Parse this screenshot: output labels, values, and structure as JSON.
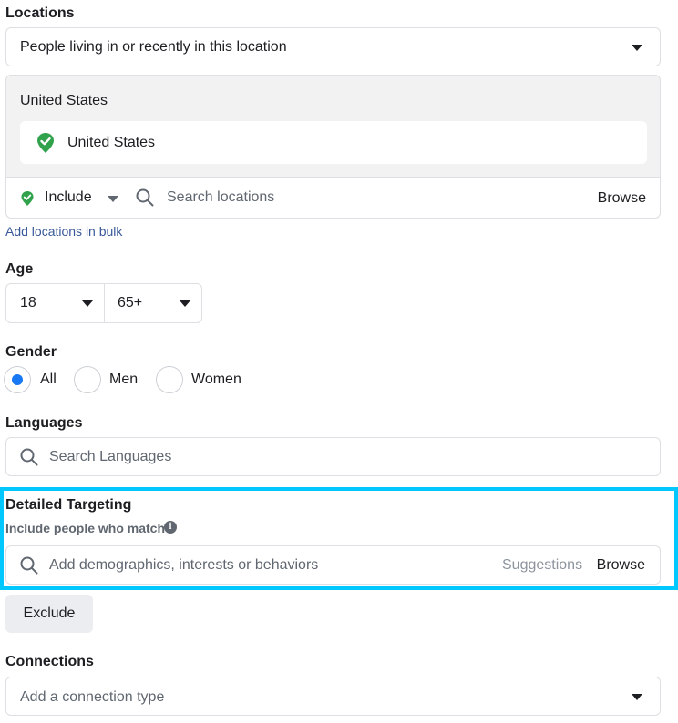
{
  "colors": {
    "accent": "#1877f2",
    "highlight": "#00c8ff",
    "location_pin": "#31a24c",
    "link": "#385898"
  },
  "locations": {
    "title": "Locations",
    "type_select": "People living in or recently in this location",
    "country_header": "United States",
    "selected": [
      {
        "label": "United States",
        "icon": "location-check-icon"
      }
    ],
    "include_mode": "Include",
    "search_placeholder": "Search locations",
    "browse_label": "Browse",
    "bulk_link": "Add locations in bulk"
  },
  "age": {
    "title": "Age",
    "min": "18",
    "max": "65+"
  },
  "gender": {
    "title": "Gender",
    "options": [
      {
        "label": "All",
        "checked": true
      },
      {
        "label": "Men",
        "checked": false
      },
      {
        "label": "Women",
        "checked": false
      }
    ]
  },
  "languages": {
    "title": "Languages",
    "search_placeholder": "Search Languages"
  },
  "detailed_targeting": {
    "title": "Detailed Targeting",
    "subtitle": "Include people who match",
    "info_icon": "info-icon",
    "search_placeholder": "Add demographics, interests or behaviors",
    "suggestions_label": "Suggestions",
    "browse_label": "Browse",
    "exclude_label": "Exclude"
  },
  "connections": {
    "title": "Connections",
    "select_placeholder": "Add a connection type"
  }
}
